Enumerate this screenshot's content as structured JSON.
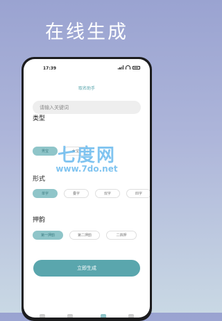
{
  "banner": {
    "title": "在线生成"
  },
  "status_bar": {
    "time": "17:39"
  },
  "app": {
    "title": "取名助手"
  },
  "search": {
    "placeholder": "请输入关键词"
  },
  "sections": {
    "type": {
      "label": "类型",
      "options": [
        "男宝",
        "女宝"
      ]
    },
    "form": {
      "label": "形式",
      "options": [
        "单字",
        "叠字",
        "双字",
        "四字"
      ]
    },
    "rhyme": {
      "label": "押韵",
      "options": [
        "第一押韵",
        "第二押韵",
        "二四押"
      ]
    }
  },
  "generate_button": {
    "label": "立即生成"
  },
  "watermark": {
    "text": "七度网",
    "url": "www.7do.net"
  },
  "colors": {
    "accent": "#5aa6ad",
    "chip_selected": "#8fc5c9",
    "background": "#a4add6"
  }
}
